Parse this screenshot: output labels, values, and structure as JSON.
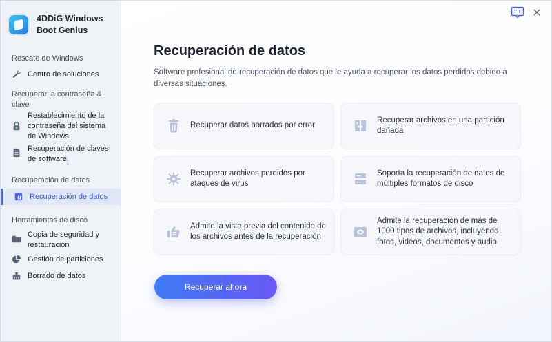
{
  "app": {
    "name": "4DDiG Windows Boot Genius",
    "name_line1": "4DDiG Windows",
    "name_line2": "Boot Genius"
  },
  "sidebar": {
    "groups": [
      {
        "label": "Rescate de Windows",
        "items": [
          {
            "label": "Centro de soluciones",
            "icon": "wrench-icon"
          }
        ]
      },
      {
        "label": "Recuperar la contraseña & clave",
        "items": [
          {
            "label": "Restablecimiento de la contraseña del sistema de Windows.",
            "icon": "lock-icon"
          },
          {
            "label": "Recuperación de claves de software.",
            "icon": "document-icon"
          }
        ]
      },
      {
        "label": "Recuperación de datos",
        "items": [
          {
            "label": "Recuperación de datos",
            "icon": "bar-chart-icon",
            "active": true
          }
        ]
      },
      {
        "label": "Herramientas de disco",
        "items": [
          {
            "label": "Copia de seguridad y restauración",
            "icon": "folder-icon"
          },
          {
            "label": "Gestión de particiones",
            "icon": "pie-chart-icon"
          },
          {
            "label": "Borrado de datos",
            "icon": "eraser-icon"
          }
        ]
      }
    ]
  },
  "topbar": {
    "feedback_icon": "feedback-icon",
    "close_icon": "close-icon"
  },
  "main": {
    "title": "Recuperación de datos",
    "subtitle": "Software profesional de recuperación de datos que le ayuda a recuperar los datos perdidos debido a diversas situaciones.",
    "features": [
      {
        "text": "Recuperar datos borrados por error",
        "icon": "trash-icon"
      },
      {
        "text": "Recuperar archivos en una partición dañada",
        "icon": "broken-partition-icon"
      },
      {
        "text": "Recuperar archivos perdidos por ataques de virus",
        "icon": "virus-icon"
      },
      {
        "text": "Soporta la recuperación de datos de múltiples formatos de disco",
        "icon": "disk-formats-icon"
      },
      {
        "text": "Admite la vista previa del contenido de los archivos antes de la recuperación",
        "icon": "thumbs-up-icon"
      },
      {
        "text": "Admite la recuperación de más de 1000 tipos de archivos, incluyendo fotos, videos, documentos y audio",
        "icon": "file-types-icon"
      }
    ],
    "cta_label": "Recuperar ahora"
  },
  "colors": {
    "accent": "#4a63f0",
    "sidebar_bg": "#eef1f6",
    "active_bg": "#dfe6f5",
    "icon_muted": "#b8c2da"
  }
}
